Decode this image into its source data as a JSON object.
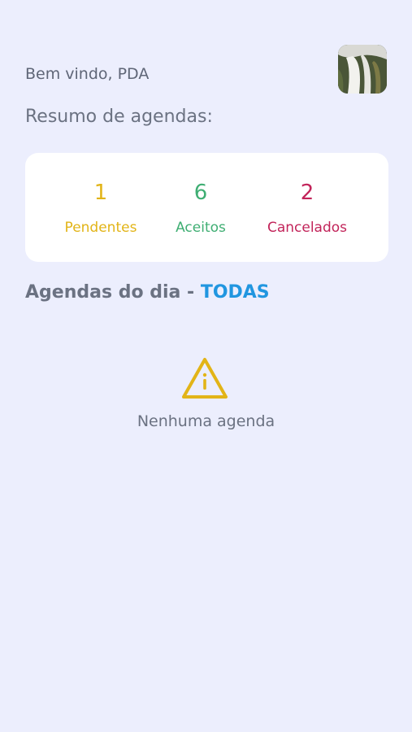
{
  "header": {
    "greeting": "Bem vindo, PDA",
    "avatar_icon": "profile-photo-waterfall"
  },
  "summary": {
    "title": "Resumo de agendas:",
    "stats": [
      {
        "count": "1",
        "label": "Pendentes",
        "color": "#e2b417"
      },
      {
        "count": "6",
        "label": "Aceitos",
        "color": "#3fae73"
      },
      {
        "count": "2",
        "label": "Cancelados",
        "color": "#c2245a"
      }
    ]
  },
  "agenda": {
    "title_prefix": "Agendas do dia - ",
    "filter": "TODAS",
    "filter_color": "#2196e0",
    "empty_icon": "warning-triangle-icon",
    "empty_icon_color": "#e2b417",
    "empty_message": "Nenhuma agenda"
  },
  "colors": {
    "background": "#eceefd",
    "card": "#ffffff",
    "text_muted": "#6b7282"
  }
}
